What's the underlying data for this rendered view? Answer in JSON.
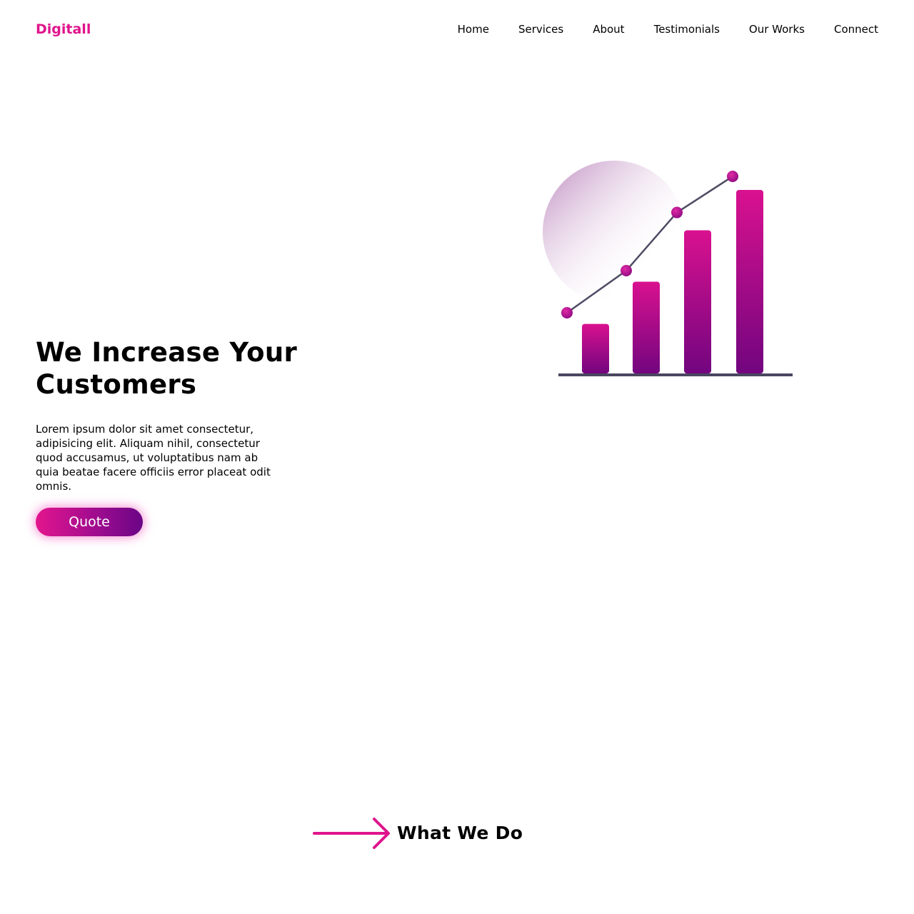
{
  "header": {
    "brand": "Digitall",
    "nav": [
      {
        "label": "Home"
      },
      {
        "label": "Services"
      },
      {
        "label": "About"
      },
      {
        "label": "Testimonials"
      },
      {
        "label": "Our Works"
      },
      {
        "label": "Connect"
      }
    ]
  },
  "hero": {
    "title": "We Increase Your Customers",
    "text": "Lorem ipsum dolor sit amet consectetur, adipisicing elit. Aliquam nihil, consectetur quod accusamus, ut voluptatibus nam ab quia beatae facere officiis error placeat odit omnis.",
    "button_label": "Quote",
    "illustration": {
      "icon": "growth-chart-illustration",
      "bar_levels": [
        0.27,
        0.5,
        0.78,
        1.0
      ],
      "line_levels": [
        0.32,
        0.53,
        0.82,
        1.0
      ]
    }
  },
  "section": {
    "title": "What We Do",
    "icon": "arrow-right-icon"
  },
  "colors": {
    "brand": "#e0148c",
    "gradient_start": "#e3158d",
    "gradient_end": "#6a0585",
    "axis": "#4a4660"
  }
}
